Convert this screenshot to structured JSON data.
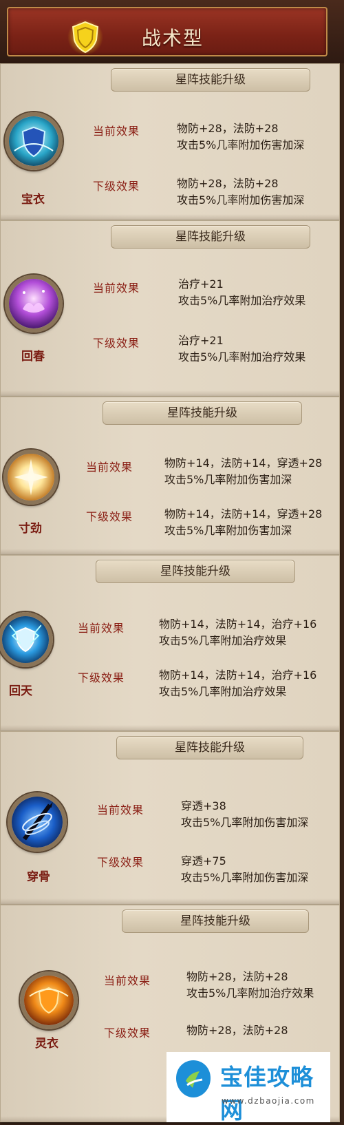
{
  "header": {
    "title": "战术型",
    "icon": "shield-icon"
  },
  "labels": {
    "current": "当前效果",
    "next": "下级效果"
  },
  "skills": [
    {
      "banner": "星阵技能升级",
      "name": "宝衣",
      "icon": "blue-shield-icon",
      "current": [
        "物防+28，法防+28",
        "攻击5%几率附加伤害加深"
      ],
      "next": [
        "物防+28，法防+28",
        "攻击5%几率附加伤害加深"
      ]
    },
    {
      "banner": "星阵技能升级",
      "name": "回春",
      "icon": "purple-lotus-icon",
      "current": [
        "治疗+21",
        "攻击5%几率附加治疗效果"
      ],
      "next": [
        "治疗+21",
        "攻击5%几率附加治疗效果"
      ]
    },
    {
      "banner": "星阵技能升级",
      "name": "寸劲",
      "icon": "golden-burst-icon",
      "current": [
        "物防+14，法防+14，穿透+28",
        "攻击5%几率附加伤害加深"
      ],
      "next": [
        "物防+14，法防+14，穿透+28",
        "攻击5%几率附加伤害加深"
      ]
    },
    {
      "banner": "星阵技能升级",
      "name": "回天",
      "icon": "lightning-shield-icon",
      "current": [
        "物防+14，法防+14，治疗+16",
        "攻击5%几率附加治疗效果"
      ],
      "next": [
        "物防+14，法防+14，治疗+16",
        "攻击5%几率附加治疗效果"
      ]
    },
    {
      "banner": "星阵技能升级",
      "name": "穿骨",
      "icon": "piercing-spear-icon",
      "current": [
        "穿透+38",
        "攻击5%几率附加伤害加深"
      ],
      "next": [
        "穿透+75",
        "攻击5%几率附加伤害加深"
      ]
    },
    {
      "banner": "星阵技能升级",
      "name": "灵衣",
      "icon": "orange-shield-icon",
      "current": [
        "物防+28，法防+28",
        "攻击5%几率附加治疗效果"
      ],
      "next": [
        "物防+28，法防+28",
        ""
      ]
    }
  ],
  "watermark": {
    "brand": "宝佳攻略网",
    "url": "www.dzbaojia.com",
    "icon": "watermark-logo-icon"
  }
}
